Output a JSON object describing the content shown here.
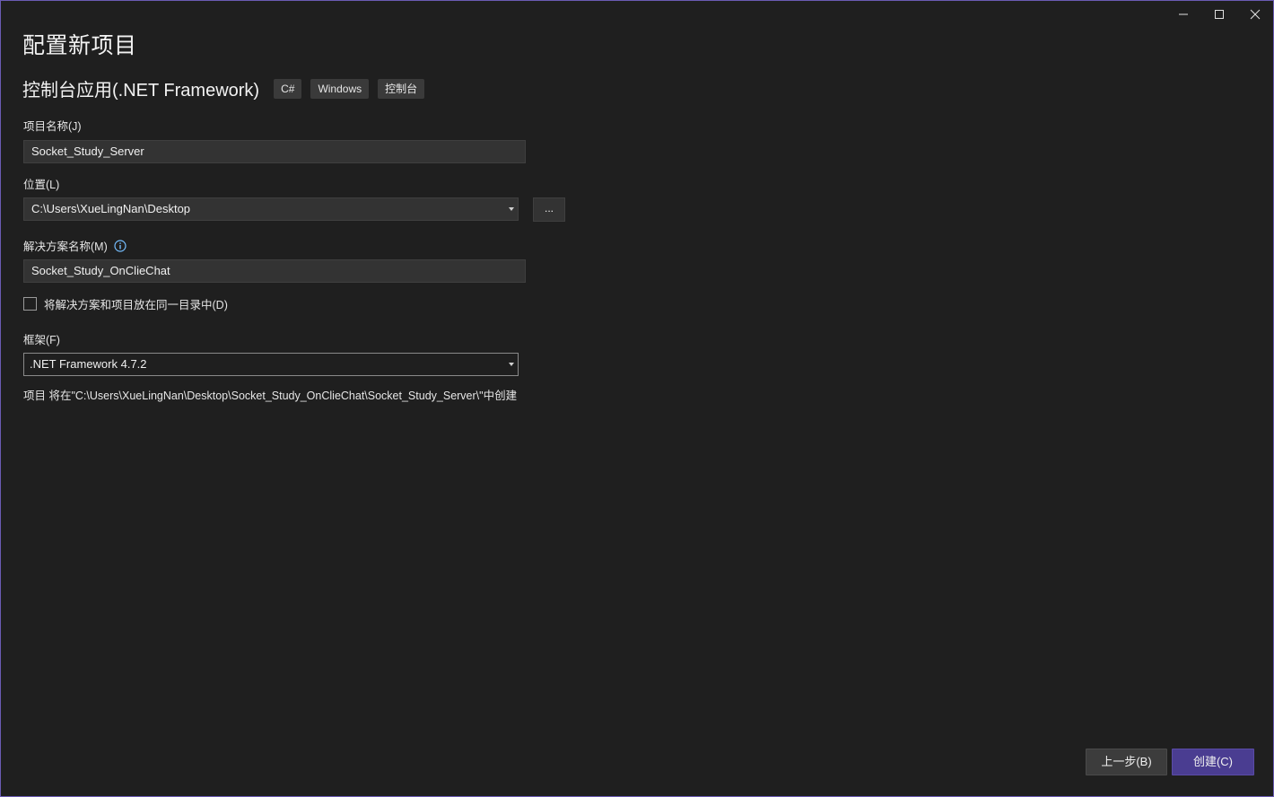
{
  "window": {
    "title": "配置新项目",
    "controls": {
      "minimize_icon": "minimize-icon",
      "maximize_icon": "maximize-icon",
      "close_icon": "close-icon"
    }
  },
  "template": {
    "name": "控制台应用(.NET Framework)",
    "tags": [
      "C#",
      "Windows",
      "控制台"
    ]
  },
  "fields": {
    "project_name": {
      "label": "项目名称(J)",
      "value": "Socket_Study_Server"
    },
    "location": {
      "label": "位置(L)",
      "value": "C:\\Users\\XueLingNan\\Desktop",
      "browse_label": "..."
    },
    "solution_name": {
      "label": "解决方案名称(M)",
      "value": "Socket_Study_OnClieChat",
      "info_icon": "info-icon"
    },
    "same_dir": {
      "label": "将解决方案和项目放在同一目录中(D)",
      "checked": false
    },
    "framework": {
      "label": "框架(F)",
      "value": ".NET Framework 4.7.2"
    }
  },
  "create_path_text": "项目 将在\"C:\\Users\\XueLingNan\\Desktop\\Socket_Study_OnClieChat\\Socket_Study_Server\\\"中创建",
  "buttons": {
    "back": "上一步(B)",
    "create": "创建(C)"
  },
  "colors": {
    "background": "#1f1f1f",
    "accent": "#4a3d91",
    "window_border": "#6b5bb3",
    "input_bg": "#333333"
  }
}
